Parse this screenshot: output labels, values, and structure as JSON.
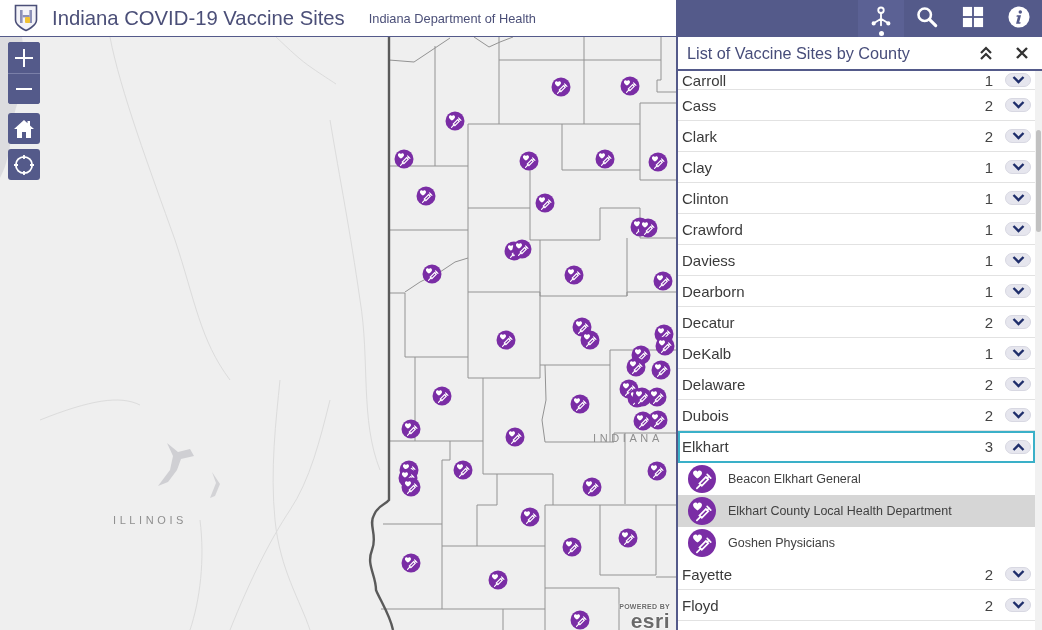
{
  "header": {
    "title": "Indiana COVID-19 Vaccine Sites",
    "subtitle": "Indiana Department of Health"
  },
  "toolbar": [
    {
      "kind": "nearby",
      "selected": true
    },
    {
      "kind": "search",
      "selected": false
    },
    {
      "kind": "widgets",
      "selected": false
    },
    {
      "kind": "info",
      "selected": false
    }
  ],
  "map": {
    "labels": [
      "ILLINOIS",
      "INDIANA"
    ],
    "attribution": [
      "POWERED BY",
      "esri"
    ]
  },
  "panel": {
    "title": "List of Vaccine Sites by County",
    "counties": [
      {
        "name": "Carroll",
        "count": "1",
        "expanded": false,
        "selected": false
      },
      {
        "name": "Cass",
        "count": "2",
        "expanded": false,
        "selected": false
      },
      {
        "name": "Clark",
        "count": "2",
        "expanded": false,
        "selected": false
      },
      {
        "name": "Clay",
        "count": "1",
        "expanded": false,
        "selected": false
      },
      {
        "name": "Clinton",
        "count": "1",
        "expanded": false,
        "selected": false
      },
      {
        "name": "Crawford",
        "count": "1",
        "expanded": false,
        "selected": false
      },
      {
        "name": "Daviess",
        "count": "1",
        "expanded": false,
        "selected": false
      },
      {
        "name": "Dearborn",
        "count": "1",
        "expanded": false,
        "selected": false
      },
      {
        "name": "Decatur",
        "count": "2",
        "expanded": false,
        "selected": false
      },
      {
        "name": "DeKalb",
        "count": "1",
        "expanded": false,
        "selected": false
      },
      {
        "name": "Delaware",
        "count": "2",
        "expanded": false,
        "selected": false
      },
      {
        "name": "Dubois",
        "count": "2",
        "expanded": false,
        "selected": false
      },
      {
        "name": "Elkhart",
        "count": "3",
        "expanded": true,
        "selected": true,
        "sites": [
          {
            "name": "Beacon Elkhart General",
            "selected": false
          },
          {
            "name": "Elkhart County Local Health Department",
            "selected": true
          },
          {
            "name": "Goshen Physicians",
            "selected": false
          }
        ]
      },
      {
        "name": "Fayette",
        "count": "2",
        "expanded": false,
        "selected": false
      },
      {
        "name": "Floyd",
        "count": "2",
        "expanded": false,
        "selected": false
      }
    ]
  }
}
